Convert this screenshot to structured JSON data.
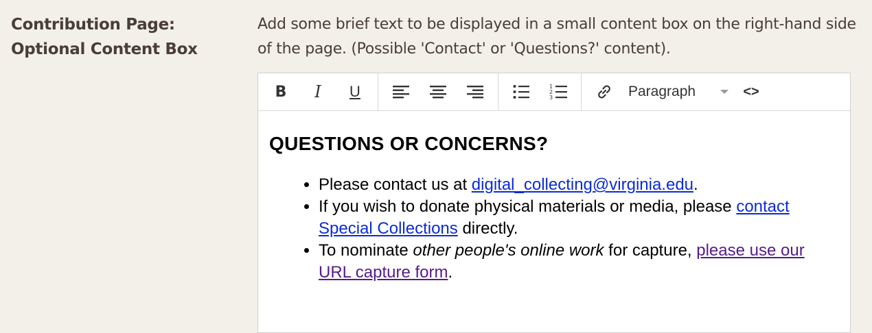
{
  "field": {
    "label": "Contribution Page: Optional Content Box",
    "description": "Add some brief text to be displayed in a small content box on the right-hand side of the page. (Possible 'Contact' or 'Questions?' content)."
  },
  "toolbar": {
    "bold_label": "B",
    "italic_label": "I",
    "underline_label": "U",
    "paragraph_select": "Paragraph",
    "code_label": "<>"
  },
  "content": {
    "heading": "QUESTIONS OR CONCERNS?",
    "item1_pre": "Please contact us at ",
    "item1_link": "digital_collecting@virginia.edu",
    "item1_post": ".",
    "item2_pre": "If you wish to donate physical materials or media, please ",
    "item2_link": "contact Special Collections",
    "item2_post": " directly.",
    "item3_pre": "To nominate ",
    "item3_em": "other people's online work",
    "item3_mid": " for capture, ",
    "item3_link": "please use our URL capture form",
    "item3_post": "."
  },
  "colors": {
    "page_bg": "#f2f0e9",
    "label_text": "#4a3d37",
    "link": "#0b2bd6",
    "visited_link": "#551a8b"
  }
}
